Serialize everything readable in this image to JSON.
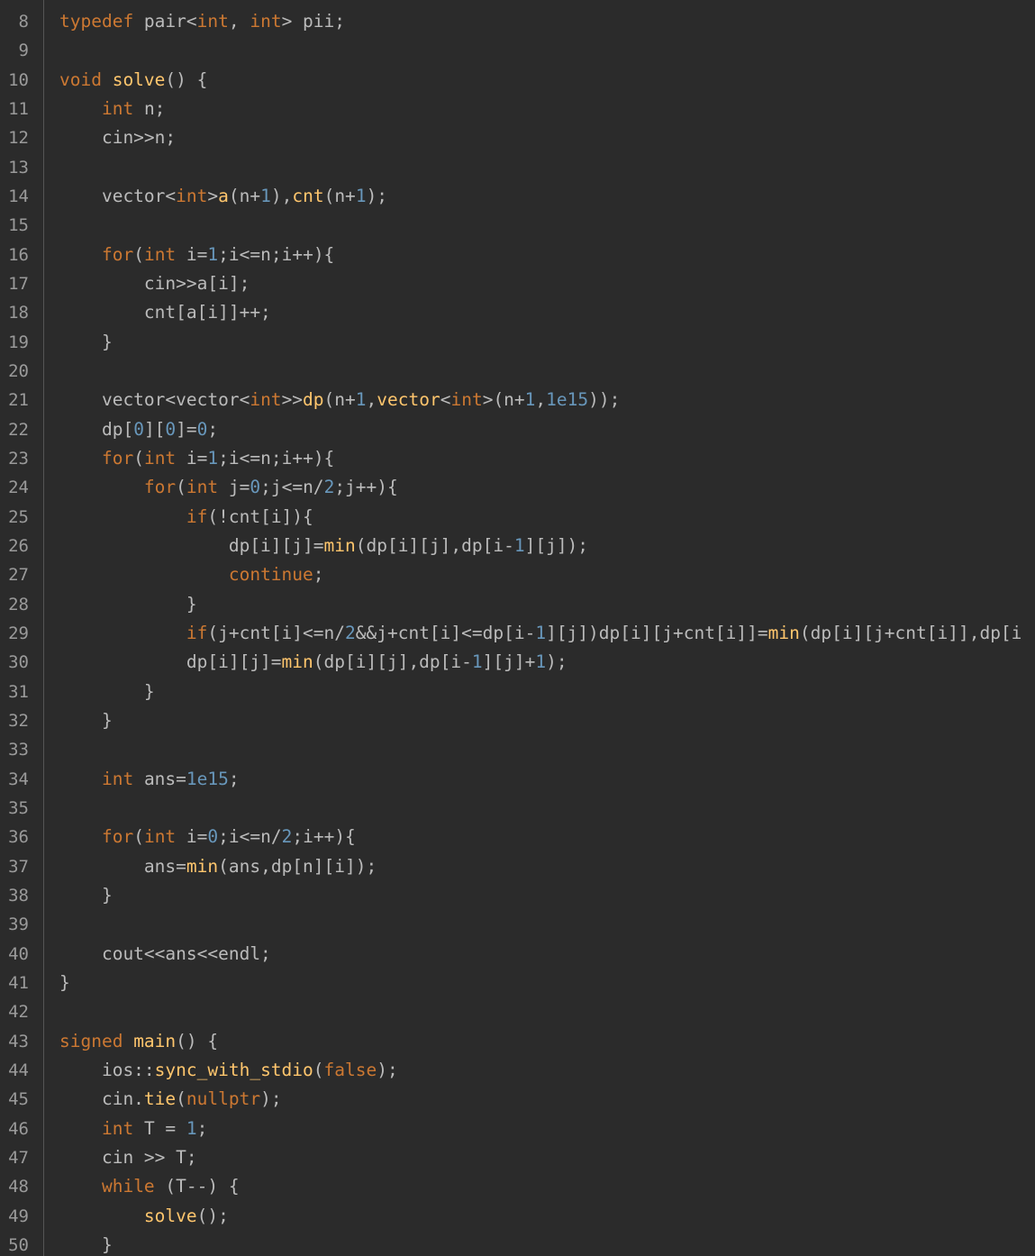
{
  "colors": {
    "background": "#2b2b2b",
    "gutter_text": "#9a9a9a",
    "default": "#bbbbbb",
    "keyword": "#cc7832",
    "number": "#6897bb",
    "function": "#ffc66d"
  },
  "lines": [
    {
      "n": "8",
      "tokens": [
        [
          "keyword",
          "typedef "
        ],
        [
          "default",
          "pair<"
        ],
        [
          "keyword",
          "int"
        ],
        [
          "default",
          ", "
        ],
        [
          "keyword",
          "int"
        ],
        [
          "default",
          "> pii;"
        ]
      ]
    },
    {
      "n": "9",
      "tokens": []
    },
    {
      "n": "10",
      "tokens": [
        [
          "keyword",
          "void "
        ],
        [
          "func",
          "solve"
        ],
        [
          "default",
          "() {"
        ]
      ]
    },
    {
      "n": "11",
      "tokens": [
        [
          "default",
          "    "
        ],
        [
          "keyword",
          "int "
        ],
        [
          "default",
          "n;"
        ]
      ]
    },
    {
      "n": "12",
      "tokens": [
        [
          "default",
          "    cin>>n;"
        ]
      ]
    },
    {
      "n": "13",
      "tokens": []
    },
    {
      "n": "14",
      "tokens": [
        [
          "default",
          "    vector<"
        ],
        [
          "keyword",
          "int"
        ],
        [
          "default",
          ">"
        ],
        [
          "func",
          "a"
        ],
        [
          "default",
          "(n+"
        ],
        [
          "number",
          "1"
        ],
        [
          "default",
          "),"
        ],
        [
          "func",
          "cnt"
        ],
        [
          "default",
          "(n+"
        ],
        [
          "number",
          "1"
        ],
        [
          "default",
          ");"
        ]
      ]
    },
    {
      "n": "15",
      "tokens": []
    },
    {
      "n": "16",
      "tokens": [
        [
          "default",
          "    "
        ],
        [
          "keyword",
          "for"
        ],
        [
          "default",
          "("
        ],
        [
          "keyword",
          "int "
        ],
        [
          "default",
          "i="
        ],
        [
          "number",
          "1"
        ],
        [
          "default",
          ";i<=n;i++){"
        ]
      ]
    },
    {
      "n": "17",
      "tokens": [
        [
          "default",
          "        cin>>a[i];"
        ]
      ]
    },
    {
      "n": "18",
      "tokens": [
        [
          "default",
          "        cnt[a[i]]++;"
        ]
      ]
    },
    {
      "n": "19",
      "tokens": [
        [
          "default",
          "    }"
        ]
      ]
    },
    {
      "n": "20",
      "tokens": []
    },
    {
      "n": "21",
      "tokens": [
        [
          "default",
          "    vector<vector<"
        ],
        [
          "keyword",
          "int"
        ],
        [
          "default",
          ">>"
        ],
        [
          "func",
          "dp"
        ],
        [
          "default",
          "(n+"
        ],
        [
          "number",
          "1"
        ],
        [
          "default",
          ","
        ],
        [
          "func",
          "vector"
        ],
        [
          "default",
          "<"
        ],
        [
          "keyword",
          "int"
        ],
        [
          "default",
          ">(n+"
        ],
        [
          "number",
          "1"
        ],
        [
          "default",
          ","
        ],
        [
          "number",
          "1e15"
        ],
        [
          "default",
          "));"
        ]
      ]
    },
    {
      "n": "22",
      "tokens": [
        [
          "default",
          "    dp["
        ],
        [
          "number",
          "0"
        ],
        [
          "default",
          "]["
        ],
        [
          "number",
          "0"
        ],
        [
          "default",
          "]="
        ],
        [
          "number",
          "0"
        ],
        [
          "default",
          ";"
        ]
      ]
    },
    {
      "n": "23",
      "tokens": [
        [
          "default",
          "    "
        ],
        [
          "keyword",
          "for"
        ],
        [
          "default",
          "("
        ],
        [
          "keyword",
          "int "
        ],
        [
          "default",
          "i="
        ],
        [
          "number",
          "1"
        ],
        [
          "default",
          ";i<=n;i++){"
        ]
      ]
    },
    {
      "n": "24",
      "tokens": [
        [
          "default",
          "        "
        ],
        [
          "keyword",
          "for"
        ],
        [
          "default",
          "("
        ],
        [
          "keyword",
          "int "
        ],
        [
          "default",
          "j="
        ],
        [
          "number",
          "0"
        ],
        [
          "default",
          ";j<=n/"
        ],
        [
          "number",
          "2"
        ],
        [
          "default",
          ";j++){"
        ]
      ]
    },
    {
      "n": "25",
      "tokens": [
        [
          "default",
          "            "
        ],
        [
          "keyword",
          "if"
        ],
        [
          "default",
          "(!cnt[i]){"
        ]
      ]
    },
    {
      "n": "26",
      "tokens": [
        [
          "default",
          "                dp[i][j]="
        ],
        [
          "func",
          "min"
        ],
        [
          "default",
          "(dp[i][j],dp[i-"
        ],
        [
          "number",
          "1"
        ],
        [
          "default",
          "][j]);"
        ]
      ]
    },
    {
      "n": "27",
      "tokens": [
        [
          "default",
          "                "
        ],
        [
          "keyword",
          "continue"
        ],
        [
          "default",
          ";"
        ]
      ]
    },
    {
      "n": "28",
      "tokens": [
        [
          "default",
          "            }"
        ]
      ]
    },
    {
      "n": "29",
      "tokens": [
        [
          "default",
          "            "
        ],
        [
          "keyword",
          "if"
        ],
        [
          "default",
          "(j+cnt[i]<=n/"
        ],
        [
          "number",
          "2"
        ],
        [
          "default",
          "&&j+cnt[i]<=dp[i-"
        ],
        [
          "number",
          "1"
        ],
        [
          "default",
          "][j])dp[i][j+cnt[i]]="
        ],
        [
          "func",
          "min"
        ],
        [
          "default",
          "(dp[i][j+cnt[i]],dp[i"
        ]
      ]
    },
    {
      "n": "30",
      "tokens": [
        [
          "default",
          "            dp[i][j]="
        ],
        [
          "func",
          "min"
        ],
        [
          "default",
          "(dp[i][j],dp[i-"
        ],
        [
          "number",
          "1"
        ],
        [
          "default",
          "][j]+"
        ],
        [
          "number",
          "1"
        ],
        [
          "default",
          ");"
        ]
      ]
    },
    {
      "n": "31",
      "tokens": [
        [
          "default",
          "        }"
        ]
      ]
    },
    {
      "n": "32",
      "tokens": [
        [
          "default",
          "    }"
        ]
      ]
    },
    {
      "n": "33",
      "tokens": []
    },
    {
      "n": "34",
      "tokens": [
        [
          "default",
          "    "
        ],
        [
          "keyword",
          "int "
        ],
        [
          "default",
          "ans="
        ],
        [
          "number",
          "1e15"
        ],
        [
          "default",
          ";"
        ]
      ]
    },
    {
      "n": "35",
      "tokens": []
    },
    {
      "n": "36",
      "tokens": [
        [
          "default",
          "    "
        ],
        [
          "keyword",
          "for"
        ],
        [
          "default",
          "("
        ],
        [
          "keyword",
          "int "
        ],
        [
          "default",
          "i="
        ],
        [
          "number",
          "0"
        ],
        [
          "default",
          ";i<=n/"
        ],
        [
          "number",
          "2"
        ],
        [
          "default",
          ";i++){"
        ]
      ]
    },
    {
      "n": "37",
      "tokens": [
        [
          "default",
          "        ans="
        ],
        [
          "func",
          "min"
        ],
        [
          "default",
          "(ans,dp[n][i]);"
        ]
      ]
    },
    {
      "n": "38",
      "tokens": [
        [
          "default",
          "    }"
        ]
      ]
    },
    {
      "n": "39",
      "tokens": []
    },
    {
      "n": "40",
      "tokens": [
        [
          "default",
          "    cout<<ans<<endl;"
        ]
      ]
    },
    {
      "n": "41",
      "tokens": [
        [
          "default",
          "}"
        ]
      ]
    },
    {
      "n": "42",
      "tokens": []
    },
    {
      "n": "43",
      "tokens": [
        [
          "keyword",
          "signed "
        ],
        [
          "func",
          "main"
        ],
        [
          "default",
          "() {"
        ]
      ]
    },
    {
      "n": "44",
      "tokens": [
        [
          "default",
          "    ios::"
        ],
        [
          "func",
          "sync_with_stdio"
        ],
        [
          "default",
          "("
        ],
        [
          "keyword",
          "false"
        ],
        [
          "default",
          ");"
        ]
      ]
    },
    {
      "n": "45",
      "tokens": [
        [
          "default",
          "    cin."
        ],
        [
          "func",
          "tie"
        ],
        [
          "default",
          "("
        ],
        [
          "keyword",
          "nullptr"
        ],
        [
          "default",
          ");"
        ]
      ]
    },
    {
      "n": "46",
      "tokens": [
        [
          "default",
          "    "
        ],
        [
          "keyword",
          "int "
        ],
        [
          "default",
          "T = "
        ],
        [
          "number",
          "1"
        ],
        [
          "default",
          ";"
        ]
      ]
    },
    {
      "n": "47",
      "tokens": [
        [
          "default",
          "    cin >> T;"
        ]
      ]
    },
    {
      "n": "48",
      "tokens": [
        [
          "default",
          "    "
        ],
        [
          "keyword",
          "while "
        ],
        [
          "default",
          "(T--) {"
        ]
      ]
    },
    {
      "n": "49",
      "tokens": [
        [
          "default",
          "        "
        ],
        [
          "func",
          "solve"
        ],
        [
          "default",
          "();"
        ]
      ]
    },
    {
      "n": "50",
      "tokens": [
        [
          "default",
          "    }"
        ]
      ]
    }
  ]
}
